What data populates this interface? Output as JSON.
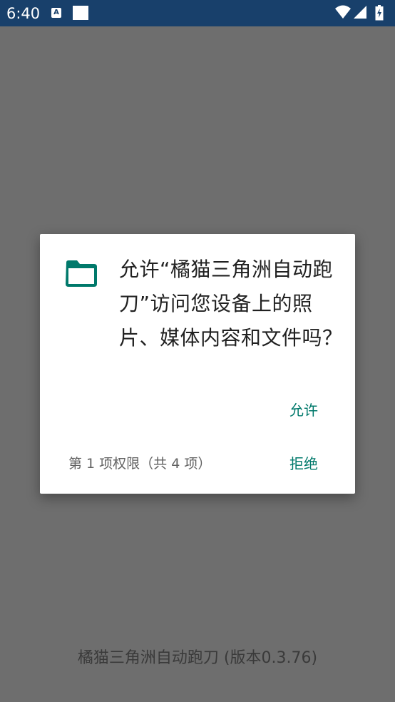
{
  "status_bar": {
    "time": "6:40",
    "notification_icons": [
      "accessibility-a-icon",
      "white-square-icon"
    ],
    "system_icons": [
      "wifi-icon",
      "signal-icon",
      "battery-icon"
    ],
    "a_glyph": "A"
  },
  "dialog": {
    "icon": "folder-icon",
    "message": "允许“橘猫三角洲自动跑刀”访问您设备上的照片、媒体内容和文件吗？",
    "allow_label": "允许",
    "deny_label": "拒绝",
    "counter": "第 1 项权限（共 4 项）"
  },
  "background": {
    "app_version": "橘猫三角洲自动跑刀 (版本0.3.76)"
  },
  "colors": {
    "accent": "#00796b",
    "status_bar": "#18406b",
    "scrim": "#6e6e6e"
  }
}
